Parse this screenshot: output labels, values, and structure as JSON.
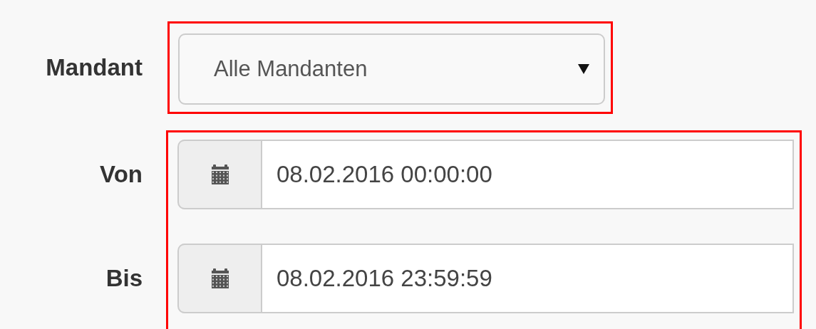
{
  "client": {
    "label": "Mandant",
    "value": "Alle Mandanten",
    "highlighted": true
  },
  "date_range": {
    "highlighted": true,
    "fields": [
      {
        "label": "Von",
        "value": "08.02.2016 00:00:00"
      },
      {
        "label": "Bis",
        "value": "08.02.2016 23:59:59"
      }
    ]
  }
}
